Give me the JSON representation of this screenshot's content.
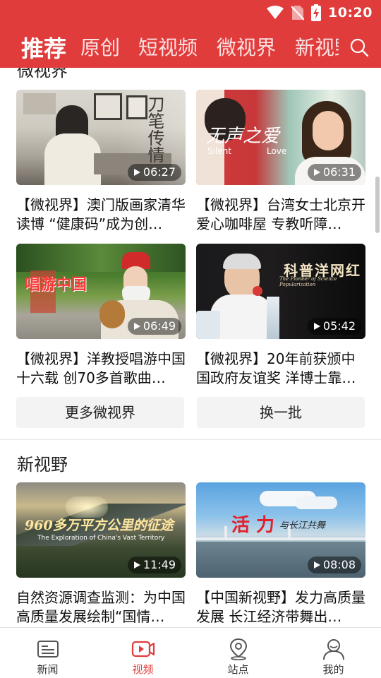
{
  "status_bar": {
    "time": "10:20"
  },
  "header": {
    "tabs": [
      {
        "label": "推荐",
        "active": true
      },
      {
        "label": "原创",
        "active": false
      },
      {
        "label": "短视频",
        "active": false
      },
      {
        "label": "微视界",
        "active": false
      },
      {
        "label": "新视野",
        "active": false
      }
    ],
    "search_icon": "search-icon"
  },
  "sections": {
    "weishijie": {
      "title": "微视界",
      "videos": [
        {
          "title": "【微视界】澳门版画家清华读博 “健康码”成为创…",
          "duration": "06:27",
          "overlay": [
            "刀",
            "笔",
            "传",
            "情"
          ]
        },
        {
          "title": "【微视界】台湾女士北京开爱心咖啡屋 专教听障…",
          "duration": "06:31",
          "overlay": [
            "无声之爱",
            "Silent",
            "Love"
          ]
        },
        {
          "title": "【微视界】洋教授唱游中国十六载 创70多首歌曲…",
          "duration": "06:49",
          "overlay": [
            "唱游中国"
          ]
        },
        {
          "title": "【微视界】20年前获颁中国政府友谊奖 洋博士靠…",
          "duration": "05:42",
          "overlay": [
            "科普洋网红",
            "The Pioneer of Science Popularization"
          ]
        }
      ],
      "more_label": "更多微视界",
      "refresh_label": "换一批"
    },
    "xinshiye": {
      "title": "新视野",
      "videos": [
        {
          "title": "自然资源调查监测：为中国高质量发展绘制“国情…",
          "duration": "11:49",
          "overlay": [
            "960多万平方公里的征途",
            "The Exploration of China's Vast Territory"
          ]
        },
        {
          "title": "【中国新视野】发力高质量发展 长江经济带舞出…",
          "duration": "08:08",
          "overlay": [
            "活 力",
            "与长江共舞"
          ]
        }
      ]
    }
  },
  "bottom_nav": [
    {
      "label": "新闻",
      "icon": "news-icon",
      "active": false
    },
    {
      "label": "视频",
      "icon": "video-icon",
      "active": true
    },
    {
      "label": "站点",
      "icon": "location-icon",
      "active": false
    },
    {
      "label": "我的",
      "icon": "profile-icon",
      "active": false
    }
  ],
  "colors": {
    "brand_red": "#e13c3c",
    "button_bg": "#f3f3f3"
  }
}
